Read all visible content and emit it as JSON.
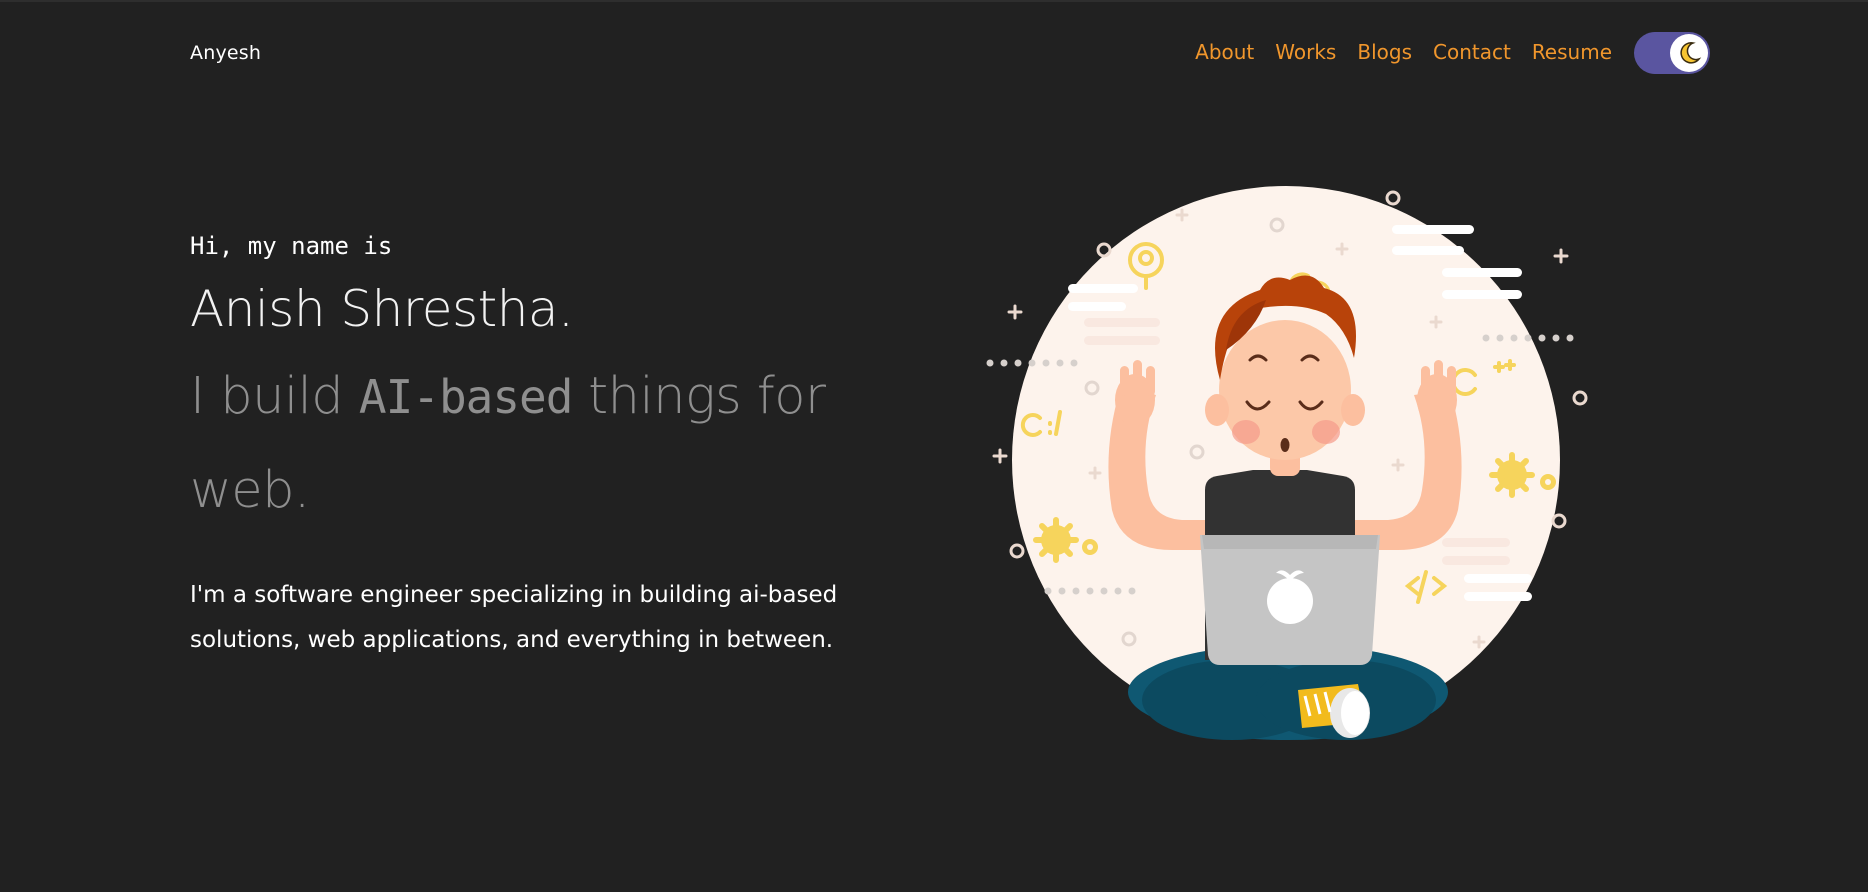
{
  "header": {
    "brand": "Anyesh",
    "nav": [
      "About",
      "Works",
      "Blogs",
      "Contact",
      "Resume"
    ]
  },
  "hero": {
    "greeting": "Hi, my name is",
    "name": "Anish Shrestha.",
    "tagline_prefix": "I build ",
    "tagline_highlight": "AI-based",
    "tagline_suffix": " things for web.",
    "description": "I'm a software engineer specializing in building ai-based solutions, web applications, and everything in between."
  },
  "illustration": {
    "laptop_logo": "apple-logo",
    "doodles": [
      "C:\\",
      "C++",
      "@",
      "</>"
    ]
  },
  "colors": {
    "background": "#212121",
    "accent": "#f0962c",
    "toggle": "#5a55a0",
    "muted_text": "#8f8f8f"
  },
  "icons": {
    "theme_toggle": "moon-icon"
  }
}
